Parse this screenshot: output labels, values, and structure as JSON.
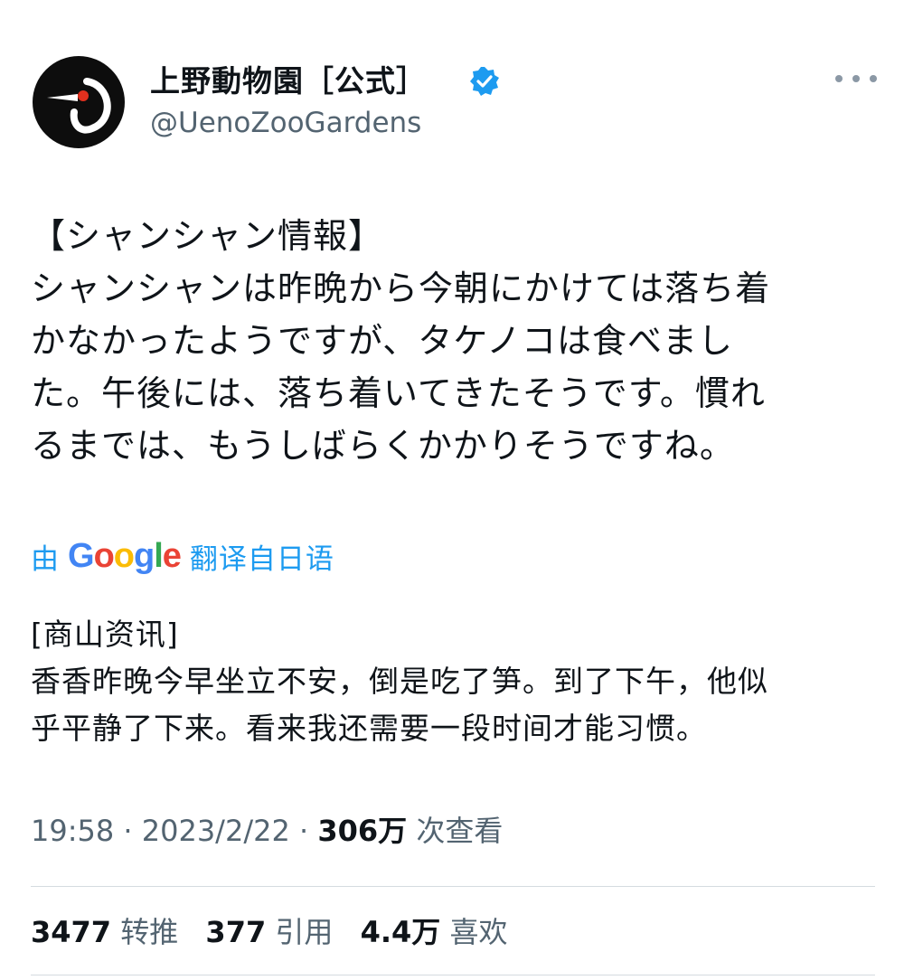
{
  "author": {
    "display_name": "上野動物園［公式］",
    "handle": "@UenoZooGardens",
    "verified": true,
    "avatar_icon": "crane-logo-icon"
  },
  "tweet": {
    "lines": [
      "【シャンシャン情報】",
      "シャンシャンは昨晩から今朝にかけては落ち着",
      "かなかったようですが、タケノコは食べまし",
      "た。午後には、落ち着いてきたそうです。慣れ",
      "るまでは、もうしばらくかかりそうですね。"
    ]
  },
  "translation": {
    "prefix": "由",
    "provider": "Google",
    "suffix": "翻译自日语",
    "lines": [
      "[商山资讯]",
      "香香昨晚今早坐立不安，倒是吃了笋。到了下午，他似",
      "乎平静了下来。看来我还需要一段时间才能习惯。"
    ]
  },
  "meta": {
    "time": "19:58",
    "separator": " · ",
    "date": "2023/2/22",
    "views": "306万",
    "views_label": " 次查看"
  },
  "stats": {
    "retweets": "3477",
    "retweets_label": " 转推",
    "quotes": "377",
    "quotes_label": " 引用",
    "likes": "4.4万",
    "likes_label": " 喜欢"
  },
  "colors": {
    "accent": "#1d9bf0",
    "secondary_text": "#536471",
    "primary_text": "#0f1419"
  }
}
